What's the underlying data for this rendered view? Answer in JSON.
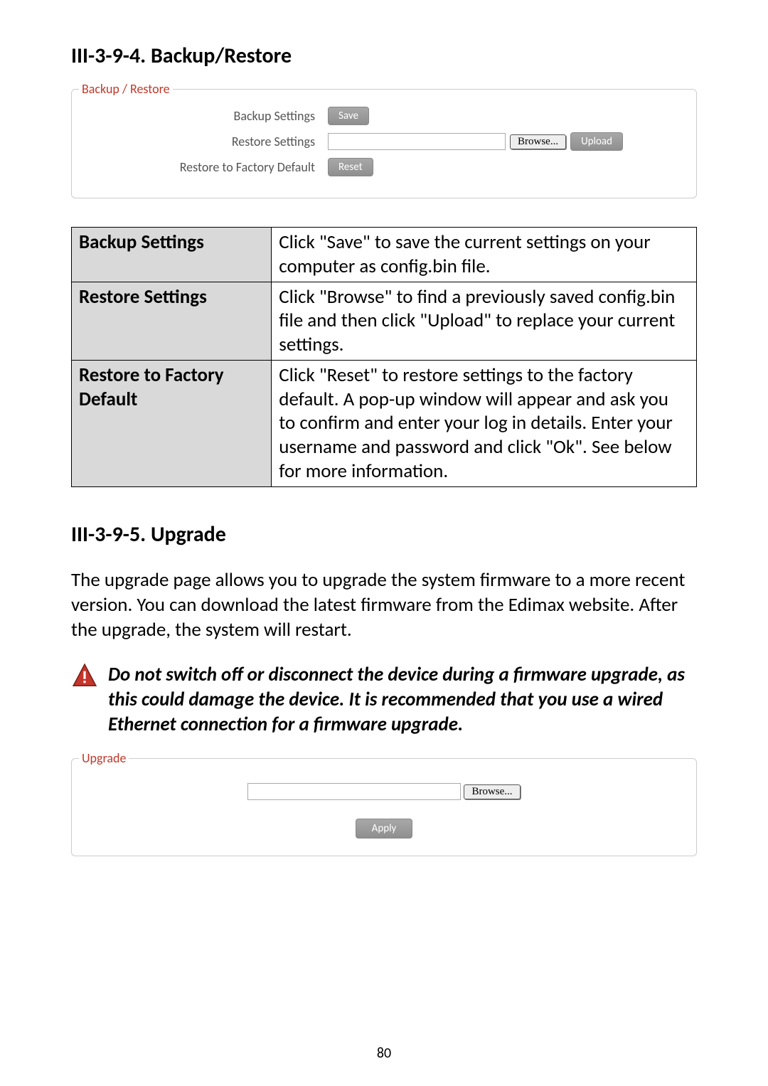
{
  "headings": {
    "backup_restore": "III-3-9-4.   Backup/Restore",
    "upgrade": "III-3-9-5.   Upgrade"
  },
  "backup_panel": {
    "legend": "Backup / Restore",
    "rows": {
      "backup_label": "Backup Settings",
      "restore_label": "Restore Settings",
      "factory_label": "Restore to Factory Default"
    },
    "buttons": {
      "save": "Save",
      "browse": "Browse...",
      "upload": "Upload",
      "reset": "Reset"
    }
  },
  "desc_table": {
    "r1": {
      "key": "Backup Settings",
      "val": "Click \"Save\" to save the current settings on your computer as config.bin file."
    },
    "r2": {
      "key": "Restore Settings",
      "val": "Click \"Browse\" to find a previously saved config.bin file and then click \"Upload\" to replace your current settings."
    },
    "r3": {
      "key": "Restore to Factory Default",
      "val": "Click \"Reset\" to restore settings to the factory default. A pop-up window will appear and ask you to confirm and enter your log in details. Enter your username and password and click \"Ok\". See below for more information."
    }
  },
  "upgrade_intro": "The upgrade page allows you to upgrade the system firmware to a more recent version. You can download the latest firmware from the Edimax website. After the upgrade, the system will restart.",
  "warning_text": "Do not switch off or disconnect the device during a firmware upgrade, as this could damage the device. It is recommended that you use a wired Ethernet connection for a firmware upgrade.",
  "upgrade_panel": {
    "legend": "Upgrade",
    "browse": "Browse...",
    "apply": "Apply"
  },
  "page_number": "80"
}
